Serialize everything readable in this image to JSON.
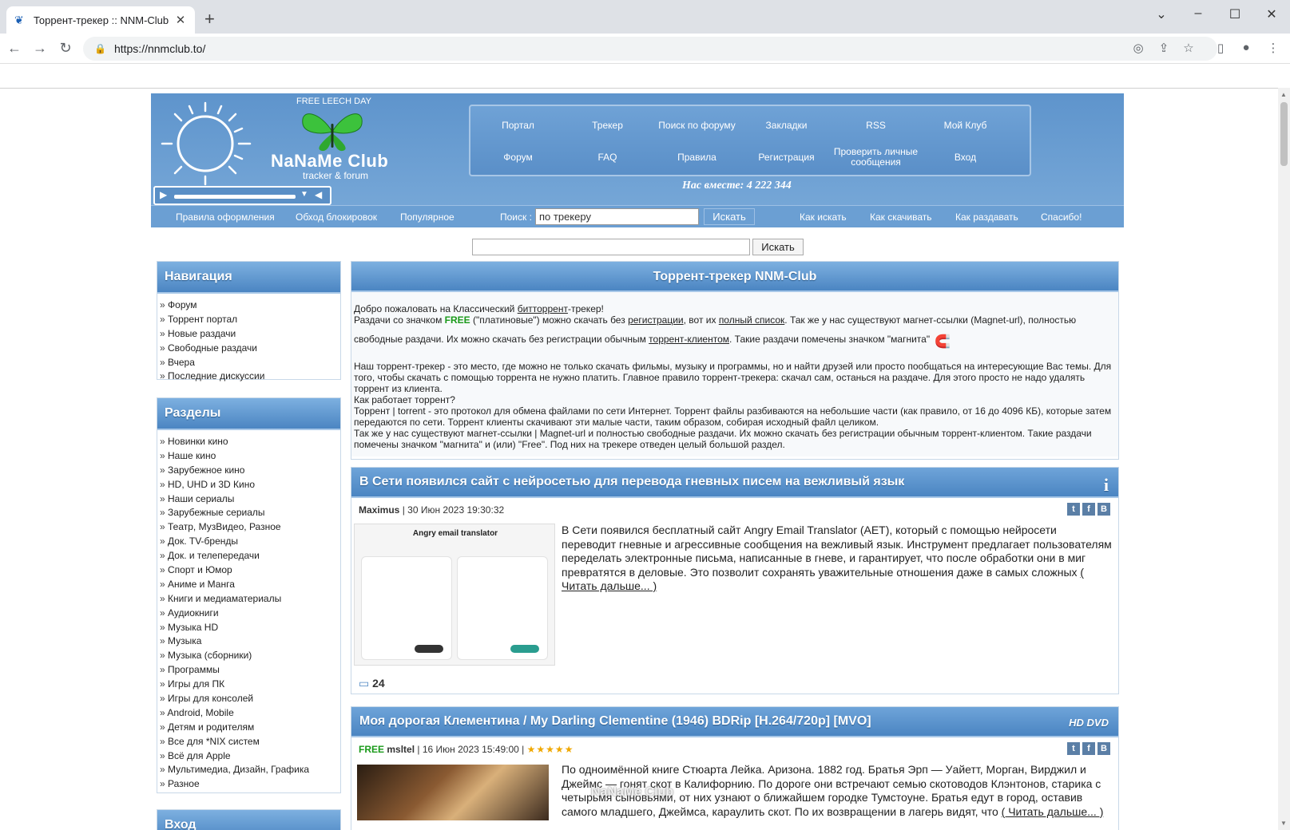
{
  "browser": {
    "tab_title": "Торрент-трекер :: NNM-Club",
    "url": "https://nnmclub.to/"
  },
  "header": {
    "free_leech": "FREE LEECH DAY",
    "logo": "NaNaMe Club",
    "tagline": "tracker & forum",
    "together": "Нас вместе: 4 222 344",
    "menu": [
      "Портал",
      "Трекер",
      "Поиск по форуму",
      "Закладки",
      "RSS",
      "Мой Клуб",
      "Форум",
      "FAQ",
      "Правила",
      "Регистрация",
      "Проверить личные сообщения",
      "Вход"
    ],
    "subbar": {
      "links_left": [
        "Правила оформления",
        "Обход блокировок",
        "Популярное"
      ],
      "search_label": "Поиск :",
      "search_value": "по трекеру",
      "search_button": "Искать",
      "links_right": [
        "Как искать",
        "Как скачивать",
        "Как раздавать",
        "Спасибо!"
      ]
    }
  },
  "search2": {
    "button": "Искать"
  },
  "sidebar": {
    "nav_title": "Навигация",
    "nav_items": [
      "Форум",
      "Торрент портал",
      "Новые раздачи",
      "Свободные раздачи",
      "Вчера",
      "Последние дискуссии"
    ],
    "sections_title": "Разделы",
    "sections": [
      "Новинки кино",
      "Наше кино",
      "Зарубежное кино",
      "HD, UHD и 3D Кино",
      "Наши сериалы",
      "Зарубежные сериалы",
      "Театр, МузВидео, Разное",
      "Док. TV-бренды",
      "Док. и телепередачи",
      "Спорт и Юмор",
      "Аниме и Манга",
      "Книги и медиаматериалы",
      "Аудиокниги",
      "Музыка HD",
      "Музыка",
      "Музыка (сборники)",
      "Программы",
      "Игры для ПК",
      "Игры для консолей",
      "Android, Mobile",
      "Детям и родителям",
      "Все для *NIX систем",
      "Всё для Apple",
      "Мультимедиа, Дизайн, Графика",
      "Разное"
    ],
    "login_title": "Вход"
  },
  "main": {
    "title": "Торрент-трекер NNM-Club",
    "intro": {
      "l1a": "Добро пожаловать на Классический ",
      "l1link": "битторрент",
      "l1b": "-трекер!",
      "l2a": "Раздачи со значком ",
      "free": "FREE",
      "l2b": " (\"платиновые\") можно скачать без ",
      "l2link1": "регистрации",
      "l2c": ", вот их ",
      "l2link2": "полный список",
      "l2d": ". Так же у нас существуют магнет-ссылки (Magnet-url), полностью",
      "l3a": "свободные раздачи. Их можно скачать без регистрации обычным ",
      "l3link": "торрент-клиентом",
      "l3b": ". Такие раздачи помечены значком \"магнита\"",
      "p2": "Наш торрент-трекер - это место, где можно не только скачать фильмы, музыку и программы, но и найти друзей или просто пообщаться на интересующие Вас темы. Для того, чтобы скачать с помощью торрента не нужно платить. Главное правило торрент-трекера: скачал сам, останься на раздаче. Для этого просто не надо удалять торрент из клиента.",
      "p3": "Как работает торрент?",
      "p4": "Торрент | torrent - это протокол для обмена файлами по сети Интернет. Торрент файлы разбиваются на небольшие части (как правило, от 16 до 4096 КБ), которые затем передаются по сети. Торрент клиенты скачивают эти малые части, таким образом, собирая исходный файл целиком.",
      "p5": "Так же у нас существуют магнет-ссылки | Magnet-url и полностью свободные раздачи. Их можно скачать без регистрации обычным торрент-клиентом. Такие раздачи помечены значком \"магнита\" и (или) \"Free\". Под них на трекере отведен целый большой раздел."
    },
    "news1": {
      "title": "В Сети появился сайт с нейросетью для перевода гневных писем на вежливый язык",
      "author": "Maximus",
      "date": "| 30 Июн 2023 19:30:32",
      "image_title": "Angry email translator",
      "body": "В Сети появился бесплатный сайт Angry Email Translator (AET), который с помощью нейросети переводит гневные и агрессивные сообщения на вежливый язык. Инструмент предлагает пользователям переделать электронные письма, написанные в гневе, и гарантирует, что после обработки они в миг превратятся в деловые. Это позволит сохранять уважительные отношения даже в самых сложных",
      "read_more": "( Читать дальше... )",
      "comments": "24"
    },
    "news2": {
      "title": "Моя дорогая Клементина / My Darling Clementine (1946) BDRip [H.264/720p] [MVO]",
      "badge": "HD DVD",
      "free": "FREE",
      "author": "msltel",
      "date": "| 16 Июн 2023 15:49:00 |",
      "stars": "★★★★★",
      "body": "По одноимённой книге Стюарта Лейка. Аризона. 1882 год. Братья Эрп — Уайетт, Морган, Вирджил и Джеймс — гонят скот в Калифорнию. По дороге они встречают семью скотоводов Клэнтонов, старика с четырьмя сыновьями, от них узнают о ближайшем городке Тумстоуне. Братья едут в город, оставив самого младшего, Джеймса, караулить скот. По их возвращении в лагерь видят, что",
      "read_more": "( Читать дальше... )"
    }
  },
  "watermark": "NaNaMe Club"
}
